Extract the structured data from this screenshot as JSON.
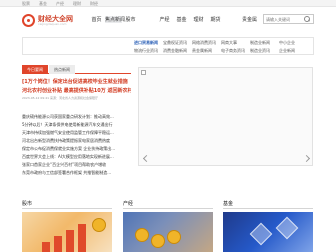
{
  "topbar": {
    "links": [
      "股票",
      "基金",
      "产经",
      "理财",
      "财经"
    ]
  },
  "logo": {
    "title": "财经大全网",
    "subtitle": "caijingdaquan.com",
    "accent_color": "#e0452b",
    "icon": "logo-circle-icon"
  },
  "nav": {
    "items": [
      "首页",
      "焦点新闻",
      "股市",
      "",
      "产经",
      "基金",
      "理财",
      "期货",
      "",
      "贵金属"
    ]
  },
  "search": {
    "placeholder": "请输入关键词",
    "icon": "search-icon"
  },
  "category_bar": {
    "row1": [
      "进口贸易新闻",
      "宝鼎权证资讯",
      "网络消费资讯",
      "网商大事",
      "制造业新闻",
      "中小企业",
      "个人创业"
    ],
    "row2": [
      "物流行业资讯",
      "消费金融新闻",
      "贵金属新闻",
      "电子商务资讯",
      "制造业资讯",
      "企业新闻",
      "小额贷款"
    ]
  },
  "left": {
    "tabs": {
      "active": "今日要闻",
      "inactive": "热点新闻"
    },
    "headlines": [
      "[1万个岗位！保定出台促进高校毕业生就业措施",
      "河北农村创业补贴 最高提供补贴10万 返回新农村"
    ],
    "subline": "2023-05-12 09:41 来源：河北省人力资源和社会保障厅",
    "news": [
      "重庆硕伟能源公司获国家重点研发计划：推动高效...",
      "5分钟以后！天津条保供电使用新能源汽车交通出行",
      "天津市持续加强燃气安全使用监管工作保障平稳运...",
      "河北出台新型消费扶持政策提振家电家居消费热度",
      "保定市公布促消费保就业实施方案 企业扶持政策出...",
      "百度世界大会上线：AI大模型应用落地实现新进展...",
      "张家口首家企业“百企兴百村”项目帮助农户增收",
      "东莞市政府与工信部签署合作框架 共推智能制造..."
    ]
  },
  "slideshow": {
    "prev": "chevron-left-icon",
    "next": "chevron-right-icon"
  },
  "sections": [
    {
      "title": "股市"
    },
    {
      "title": "产经"
    },
    {
      "title": "基金"
    }
  ]
}
